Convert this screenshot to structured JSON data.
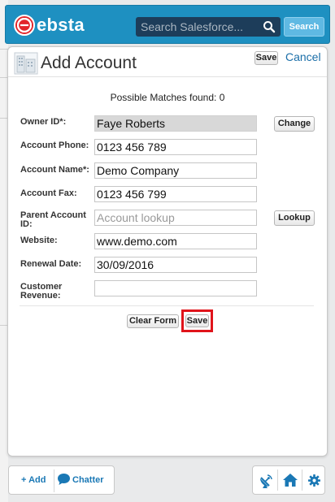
{
  "header": {
    "logo_letter": "e",
    "logo_text": "ebsta",
    "search_placeholder": "Search Salesforce...",
    "search_button": "Search"
  },
  "panel": {
    "title": "Add Account",
    "save_label": "Save",
    "cancel_label": "Cancel",
    "matches_text": "Possible Matches found: 0"
  },
  "form": {
    "owner": {
      "label": "Owner ID*:",
      "value": "Faye Roberts",
      "button": "Change"
    },
    "phone": {
      "label": "Account Phone:",
      "value": "0123 456 789"
    },
    "name": {
      "label": "Account Name*:",
      "value": "Demo Company"
    },
    "fax": {
      "label": "Account Fax:",
      "value": "0123 456 799"
    },
    "parent": {
      "label_line1": "Parent Account",
      "label_line2": "ID:",
      "placeholder": "Account lookup",
      "button": "Lookup"
    },
    "website": {
      "label": "Website:",
      "value": "www.demo.com"
    },
    "renewal": {
      "label": "Renewal Date:",
      "value": "30/09/2016"
    },
    "revenue": {
      "label_line1": "Customer",
      "label_line2": "Revenue:",
      "value": ""
    }
  },
  "actions": {
    "clear_label": "Clear Form",
    "save_label": "Save"
  },
  "footer": {
    "add_label": "+ Add",
    "chatter_label": "Chatter"
  },
  "colors": {
    "brand_blue": "#1e90c1",
    "logo_red": "#e2262b",
    "highlight_red": "#e0141b",
    "link_blue": "#1a78b5"
  }
}
